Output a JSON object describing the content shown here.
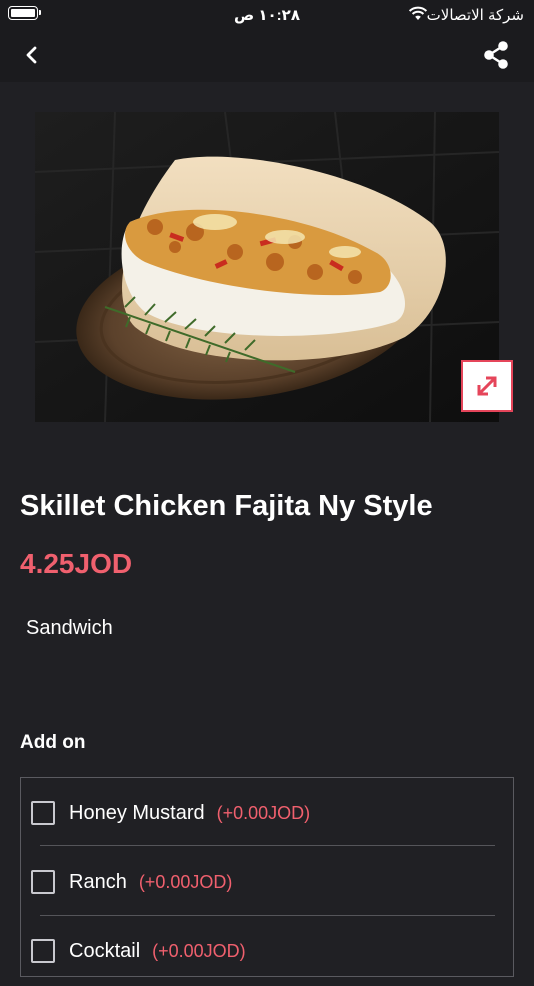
{
  "status_bar": {
    "time": "١٠:٢٨ ص",
    "carrier": "شركة الاتصالات",
    "battery_icon": "battery-icon",
    "wifi_icon": "wifi-icon"
  },
  "nav": {
    "back_icon": "chevron-left-icon",
    "share_icon": "share-icon"
  },
  "product": {
    "image_alt": "sandwich-photo",
    "expand_icon": "expand-icon",
    "title": "Skillet Chicken Fajita Ny Style",
    "price": "4.25JOD",
    "category": "Sandwich"
  },
  "addons": {
    "heading": "Add on",
    "items": [
      {
        "name": "Honey Mustard",
        "price": "(+0.00JOD)"
      },
      {
        "name": "Ranch",
        "price": "(+0.00JOD)"
      },
      {
        "name": "Cocktail",
        "price": "(+0.00JOD)"
      }
    ]
  },
  "colors": {
    "background": "#202024",
    "bar": "#1b1b1e",
    "accent": "#f0606e",
    "expand_border": "#e5455a"
  }
}
